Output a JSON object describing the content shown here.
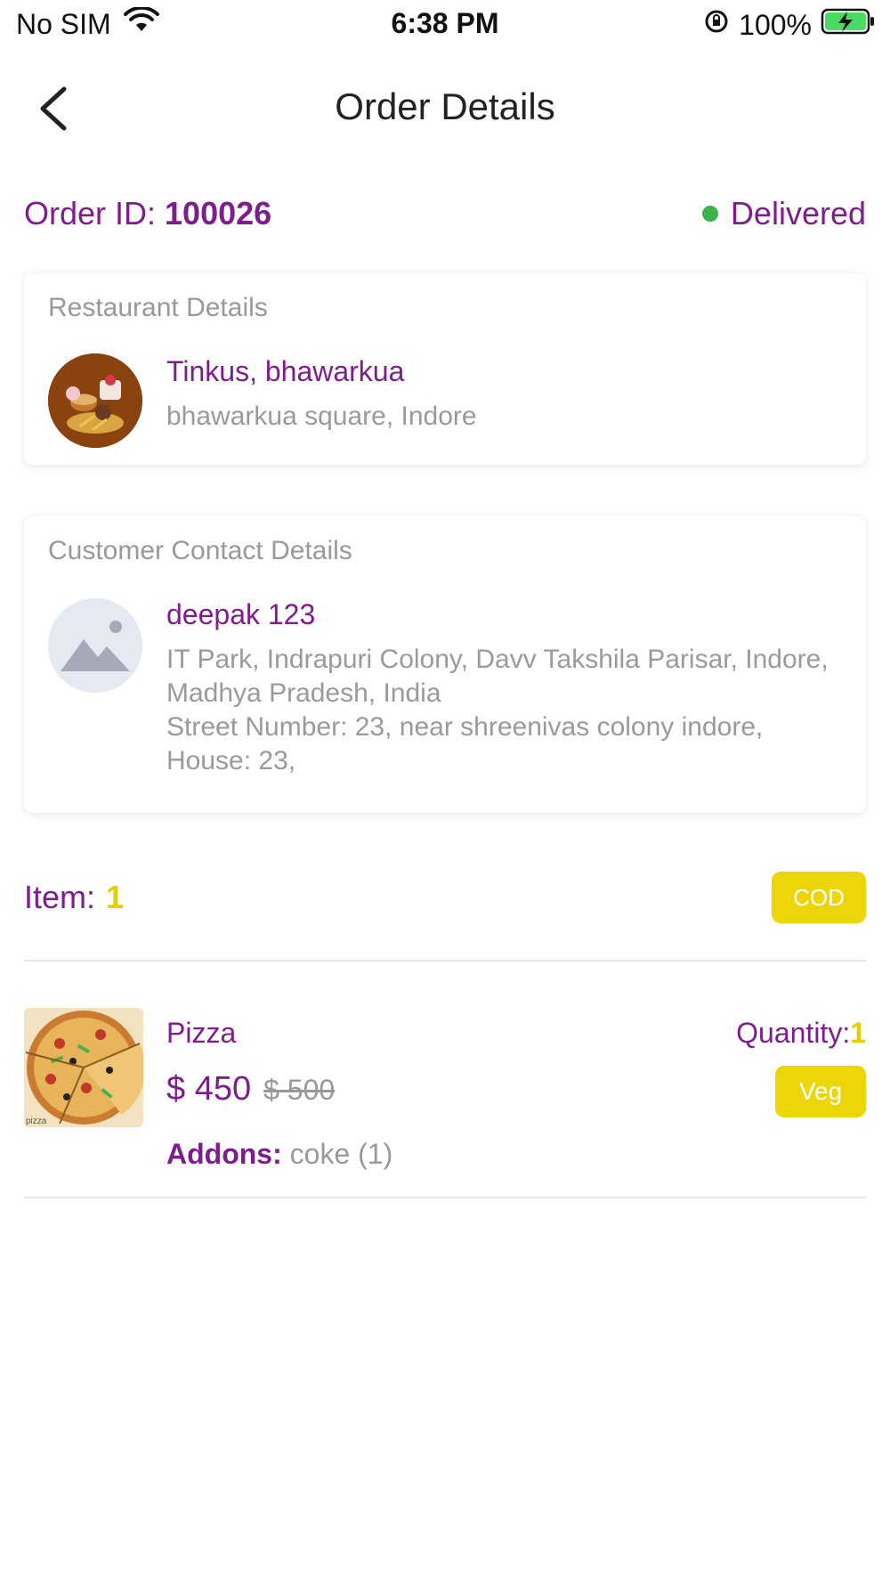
{
  "status_bar": {
    "carrier": "No SIM",
    "time": "6:38 PM",
    "battery": "100%"
  },
  "nav": {
    "title": "Order Details"
  },
  "order": {
    "id_label": "Order ID:",
    "id": "100026",
    "status": "Delivered",
    "status_color": "#3bb54a"
  },
  "restaurant": {
    "section_title": "Restaurant Details",
    "name": "Tinkus, bhawarkua",
    "address": "bhawarkua square, Indore"
  },
  "customer": {
    "section_title": "Customer Contact Details",
    "name": "deepak 123",
    "address_line1": "IT Park, Indrapuri Colony, Davv Takshila Parisar, Indore, Madhya Pradesh, India",
    "address_line2": "Street Number: 23, near shreenivas colony indore, House: 23,"
  },
  "items_summary": {
    "label": "Item:",
    "count": "1",
    "payment": "COD"
  },
  "items": [
    {
      "name": "Pizza",
      "price": "$ 450",
      "original_price": "$ 500",
      "quantity_label": "Quantity:",
      "quantity": "1",
      "type": "Veg",
      "addons_label": "Addons:",
      "addons": "coke (1)",
      "image_caption": "pizza"
    }
  ],
  "colors": {
    "primary": "#7f1d8e",
    "accent": "#ecd608"
  }
}
